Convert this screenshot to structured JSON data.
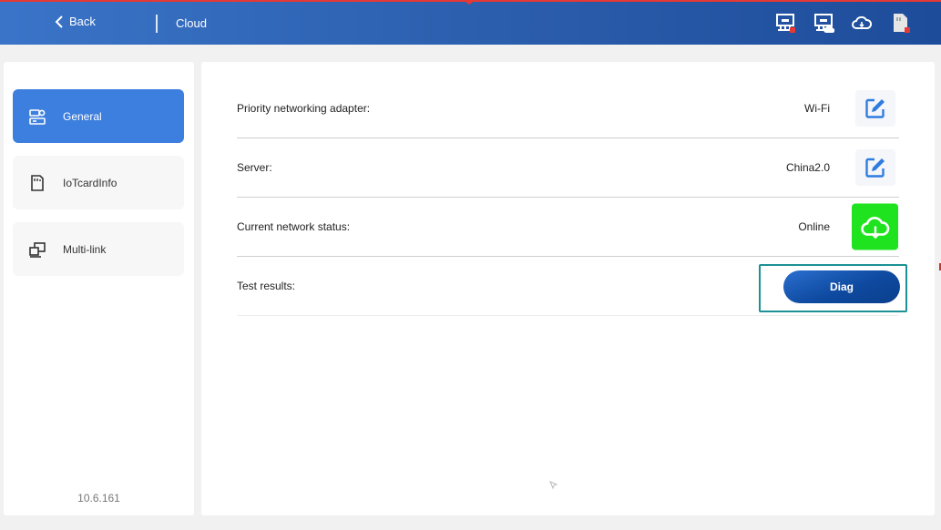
{
  "header": {
    "back_label": "Back",
    "title": "Cloud",
    "status_icons": [
      "network-adapter-error-icon",
      "network-cloud-icon",
      "cloud-icon",
      "sim-card-error-icon"
    ]
  },
  "sidebar": {
    "items": [
      {
        "label": "General",
        "icon": "settings-card-icon",
        "active": true
      },
      {
        "label": "IoTcardInfo",
        "icon": "sim-card-icon",
        "active": false
      },
      {
        "label": "Multi-link",
        "icon": "multi-link-icon",
        "active": false
      }
    ],
    "version": "10.6.161"
  },
  "main": {
    "rows": [
      {
        "label": "Priority networking adapter:",
        "value": "Wi-Fi",
        "action": "edit-icon"
      },
      {
        "label": "Server:",
        "value": "China2.0",
        "action": "edit-icon"
      },
      {
        "label": "Current network status:",
        "value": "Online",
        "action": "cloud-icon"
      },
      {
        "label": "Test results:",
        "value": ""
      }
    ],
    "diag_label": "Diag"
  },
  "colors": {
    "header_start": "#3a74c8",
    "header_end": "#1d4c9a",
    "accent_blue": "#3d7fde",
    "online_green": "#1ee31e",
    "diag_frame": "#1b9196",
    "error_red": "#e53935"
  }
}
